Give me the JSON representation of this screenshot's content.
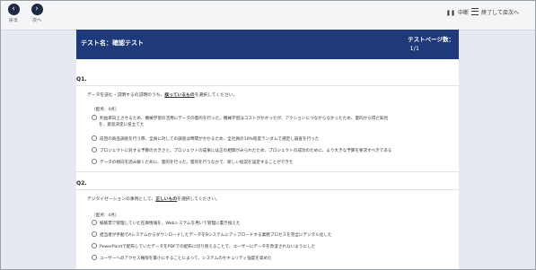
{
  "toolbar": {
    "back_label": "戻る",
    "next_label": "次へ",
    "pause_label": "中断",
    "end_label": "終了して戻次へ",
    "back_icon": "chevron-left-icon",
    "next_icon": "chevron-right-icon"
  },
  "header": {
    "test_name": "テスト名：確認テスト",
    "page_label": "テストページ数：",
    "page_value": "1/1"
  },
  "questions": [
    {
      "title": "Q1.",
      "text_before": "データを読む・説明するの説明のうち、",
      "text_em": "誤っているもの",
      "text_after": "を選択してください。",
      "points": "（配点：4点）",
      "options": [
        "利益率向上させるため、機械学習の活用にデータの量的を行った。機械学習はコストがかかったが、アクションにつながらなかったため、量的から得た知見",
        "前回の商品調査を行う際、全員に対しての調査は時間がかかるため、全社員の10%程度ランダムで選定し調査を行った",
        "プロジェクトに対する予算の大きさと、プロジェクトの成果には正の相関がみられたため、プロジェクトの成功のために、より大きな予算を要求すべきである",
        "データの傾向を読み解くために、量的を行った。量的を行うなかで、新しい仮説を設定することができた"
      ],
      "option1_cont": "を、意思決定に役立てた"
    },
    {
      "title": "Q2.",
      "text_before": "デジタイゼーションの事例として、",
      "text_em": "正しいもの",
      "text_after": "を選択してください。",
      "points": "（配点：4点）",
      "options": [
        "紙帳票で管理していた在庫情報を、Webシステムを用いて管理に置き換えた",
        "担当者が手動でAシステムからダウンロードしたデータをBシステムにアップロードする業務プロセスを完全にデジタル化した",
        "PowerPointで配布していたデータをPDFでの配布に切り替えることで、ユーザーにデータを改変されないようにした",
        "ユーザーへのアクセス権限を最小にすることによって、システムのセキュリティ強度を高めた"
      ]
    }
  ]
}
